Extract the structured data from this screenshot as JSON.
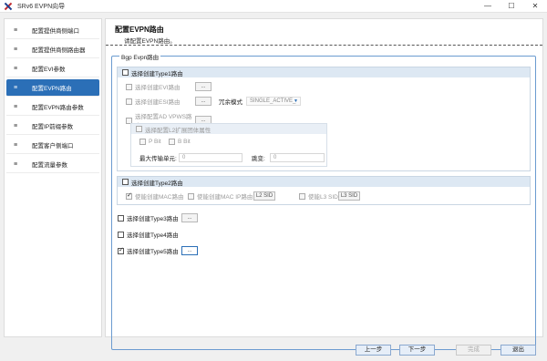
{
  "window": {
    "title": "SRv6 EVPN向导",
    "controls": [
      "—",
      "☐",
      "✕"
    ]
  },
  "sidebar": {
    "items": [
      {
        "label": "配置提供商侧端口"
      },
      {
        "label": "配置提供商侧路由器"
      },
      {
        "label": "配置EVI参数"
      },
      {
        "label": "配置EVPN路由"
      },
      {
        "label": "配置EVPN路由参数"
      },
      {
        "label": "配置IP前缀参数"
      },
      {
        "label": "配置客户侧端口"
      },
      {
        "label": "配置流量参数"
      }
    ],
    "icon": "≡"
  },
  "page": {
    "title": "配置EVPN路由",
    "subtitle": "请配置EVPN路由。"
  },
  "group": {
    "label": "Bgp Evpn路由"
  },
  "type1": {
    "label": "选择创建Type1路由",
    "evi": "选择创建EVI路由",
    "esi": "选择创建ESI路由",
    "redundancy_label": "冗余模式",
    "redundancy_value": "SINGLE_ACTIVE_",
    "ad": "选择配置AD VPWS路由",
    "l2": "选择配置L2扩展团体属性",
    "p_bit": "P Bit",
    "b_bit": "B Bit",
    "mtu_label": "最大传输单元:",
    "mtu_value": "0",
    "vlan_label": "跳变:",
    "vlan_value": "0",
    "dots": "..."
  },
  "type2": {
    "label": "选择创建Type2路由",
    "mac": "使能创建MAC路由",
    "mac_ip": "使能创建MAC IP路由",
    "l2sid": "L2 SID",
    "l3": "使能L3 SID",
    "l3sid": "L3 SID"
  },
  "type3": {
    "label": "选择创建Type3路由",
    "dots": "..."
  },
  "type4": {
    "label": "选择创建Type4路由"
  },
  "type5": {
    "label": "选择创建Type5路由",
    "dots": "..."
  },
  "footer": {
    "prev": "上一步",
    "next": "下一步",
    "finish": "完成",
    "exit": "退出"
  },
  "colors": {
    "accent": "#2b6fb7",
    "header_fill": "#dde8f3",
    "border": "#6b9bd0"
  }
}
